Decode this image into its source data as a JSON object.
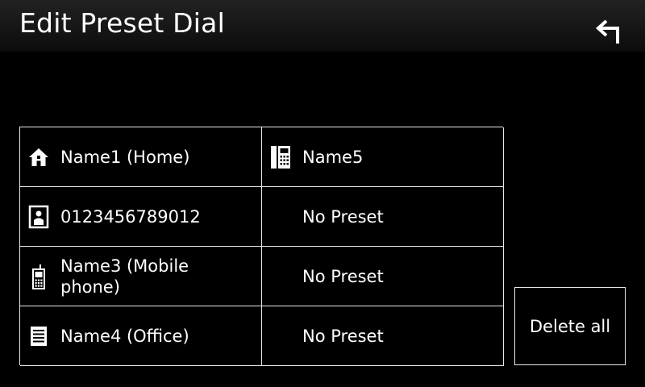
{
  "header": {
    "title": "Edit Preset Dial",
    "back_icon": "return-arrow-icon"
  },
  "presets": {
    "items": [
      {
        "label": "Name1 (Home)",
        "icon": "home-icon"
      },
      {
        "label": "0123456789012",
        "icon": "contact-icon"
      },
      {
        "label": "Name3 (Mobile phone)",
        "icon": "mobile-phone-icon"
      },
      {
        "label": "Name4 (Office)",
        "icon": "office-icon"
      },
      {
        "label": "Name5",
        "icon": "general-phone-icon"
      },
      {
        "label": "No Preset",
        "icon": ""
      },
      {
        "label": "No Preset",
        "icon": ""
      },
      {
        "label": "No Preset",
        "icon": ""
      }
    ]
  },
  "actions": {
    "delete_all_label": "Delete all"
  },
  "colors": {
    "background": "#000000",
    "text": "#ffffff",
    "border": "#e8e8e8"
  }
}
